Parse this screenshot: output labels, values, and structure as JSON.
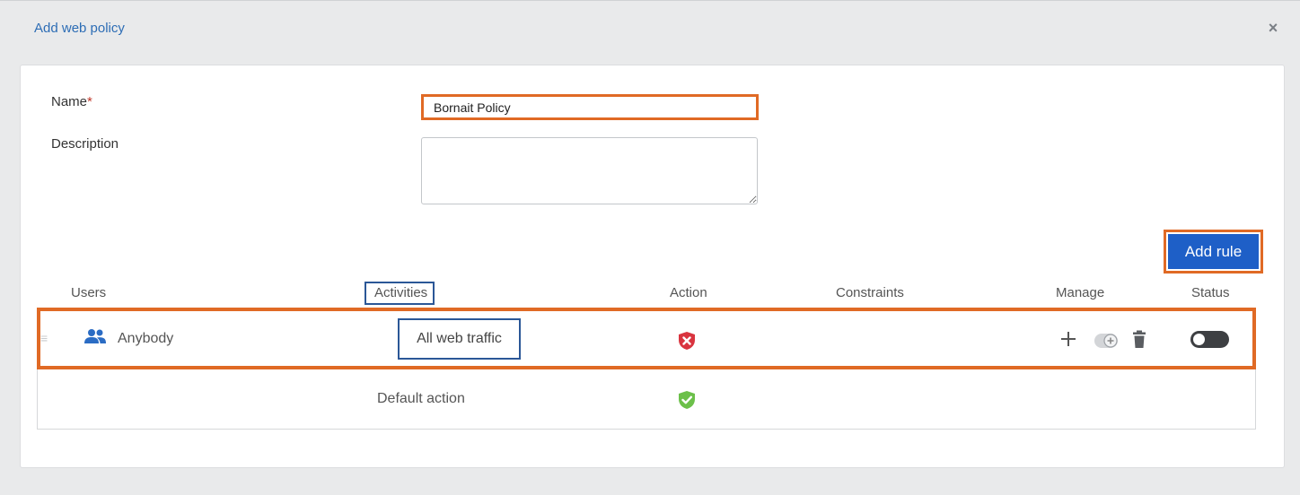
{
  "dialog": {
    "title": "Add web policy",
    "close_symbol": "×"
  },
  "form": {
    "name_label": "Name",
    "name_required_mark": "*",
    "name_value": "Bornait Policy",
    "description_label": "Description",
    "description_value": ""
  },
  "toolbar": {
    "add_rule_label": "Add rule"
  },
  "table": {
    "headers": {
      "users": "Users",
      "activities": "Activities",
      "action": "Action",
      "constraints": "Constraints",
      "manage": "Manage",
      "status": "Status"
    },
    "rule": {
      "users": "Anybody",
      "users_icon": "users-icon",
      "activity": "All web traffic",
      "action_icon": "block-shield-icon",
      "status_enabled": false
    },
    "default_row": {
      "label": "Default action",
      "action_icon": "allow-shield-icon"
    }
  },
  "colors": {
    "accent_blue": "#1e5fc7",
    "title_blue": "#2d6db5",
    "highlight_orange": "#e06a25",
    "highlight_blue": "#2b5797",
    "block_red": "#d9343f",
    "allow_green": "#6cc04a"
  }
}
